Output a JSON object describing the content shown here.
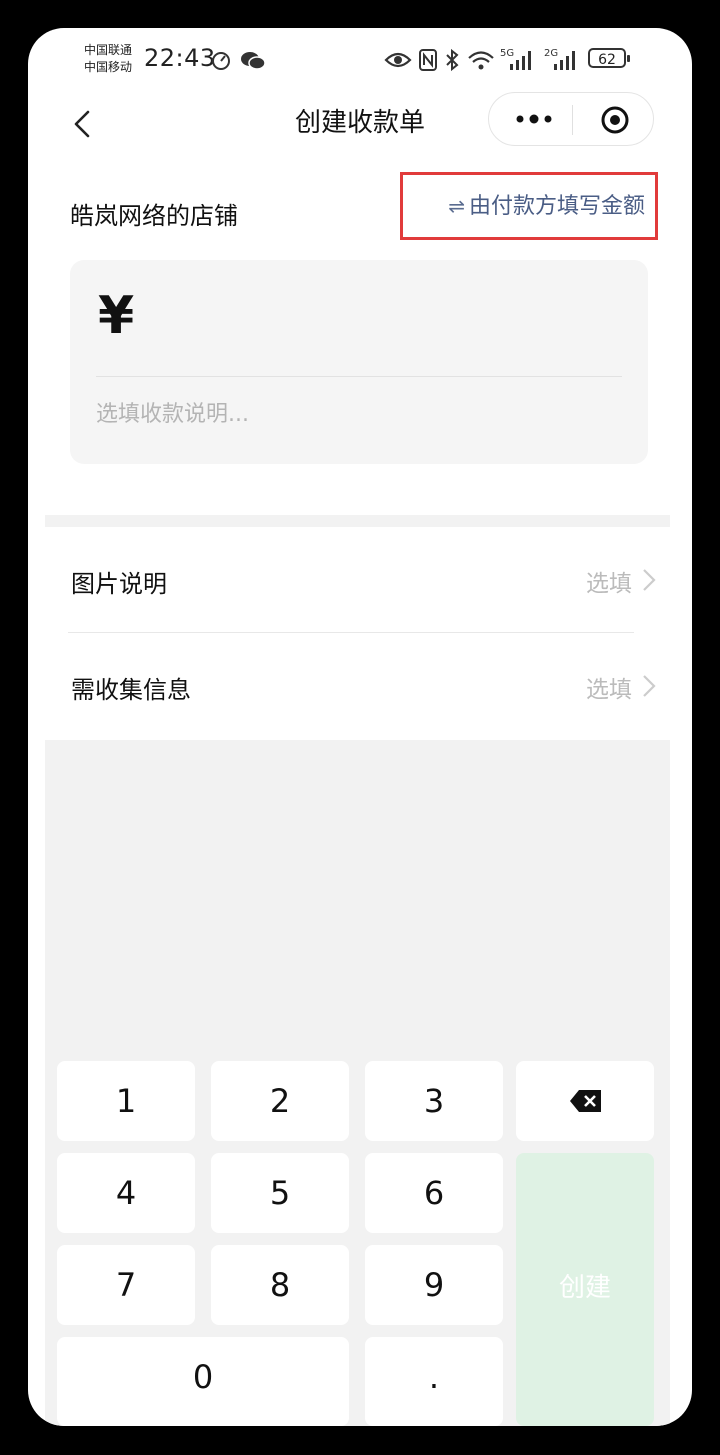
{
  "status_bar": {
    "carrier_1": "中国联通",
    "carrier_2": "中国移动",
    "time": "22:43",
    "battery": "62"
  },
  "nav": {
    "title": "创建收款单"
  },
  "shop_name": "皓岚网络的店铺",
  "mode_toggle": "由付款方填写金额",
  "amount": {
    "currency_symbol": "¥",
    "description_placeholder": "选填收款说明..."
  },
  "rows": [
    {
      "label": "图片说明",
      "value": "选填"
    },
    {
      "label": "需收集信息",
      "value": "选填"
    }
  ],
  "keypad": {
    "keys": [
      "1",
      "2",
      "3",
      "4",
      "5",
      "6",
      "7",
      "8",
      "9",
      "0",
      "."
    ],
    "create_label": "创建"
  },
  "colors": {
    "accent_link": "#4a5d85",
    "highlight_box": "#e13b3b",
    "create_button_disabled": "#dff2e4"
  }
}
